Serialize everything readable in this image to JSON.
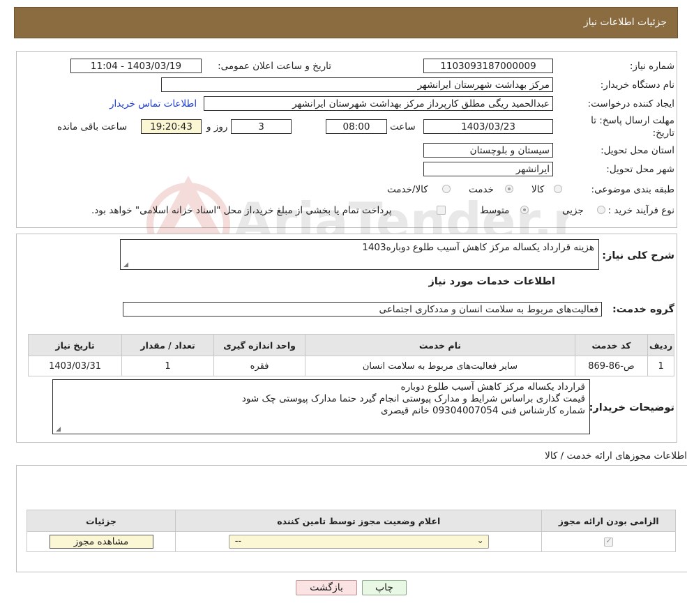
{
  "header": {
    "title": "جزئیات اطلاعات نیاز"
  },
  "need": {
    "number_label": "شماره نیاز:",
    "number": "1103093187000009",
    "announce_label": "تاریخ و ساعت اعلان عمومی:",
    "announce_value": "1403/03/19 - 11:04",
    "buyer_label": "نام دستگاه خریدار:",
    "buyer": "مرکز بهداشت شهرستان ایرانشهر",
    "creator_label": "ایجاد کننده درخواست:",
    "creator": "عبدالحمید ریگی مطلق کارپرداز مرکز بهداشت شهرستان ایرانشهر",
    "contact_link": "اطلاعات تماس خریدار",
    "deadline_label_1": "مهلت ارسال پاسخ: تا",
    "deadline_label_2": "تاریخ:",
    "deadline_date": "1403/03/23",
    "time_label": "ساعت",
    "deadline_time": "08:00",
    "days": "3",
    "days_label": "روز و",
    "remaining": "19:20:43",
    "remaining_label": "ساعت باقی مانده",
    "province_label": "استان محل تحویل:",
    "province": "سیستان و بلوچستان",
    "city_label": "شهر محل تحویل:",
    "city": "ایرانشهر",
    "category_label": "طبقه بندی موضوعی:",
    "category_options": [
      "کالا",
      "خدمت",
      "کالا/خدمت"
    ],
    "process_label": "نوع فرآیند خرید :",
    "process_options": [
      "جزیی",
      "متوسط"
    ],
    "payment_note": "پرداخت تمام یا بخشی از مبلغ خرید،از محل \"اسناد خزانه اسلامی\" خواهد بود."
  },
  "summary": {
    "label": "شرح کلی نیاز:",
    "value": "هزینه قرارداد یکساله مرکز کاهش آسیب طلوع دوباره1403",
    "services_title": "اطلاعات خدمات مورد نیاز",
    "group_label": "گروه خدمت:",
    "group_value": "فعالیت‌های مربوط به سلامت انسان و مددکاری اجتماعی"
  },
  "services_table": {
    "headers": [
      "ردیف",
      "کد خدمت",
      "نام خدمت",
      "واحد اندازه گیری",
      "تعداد / مقدار",
      "تاریخ نیاز"
    ],
    "rows": [
      [
        "1",
        "ص-86-869",
        "سایر فعالیت‌های مربوط به سلامت انسان",
        "فقره",
        "1",
        "1403/03/31"
      ]
    ]
  },
  "buyer_notes": {
    "label": "توضیحات خریدار:",
    "line1": "قرارداد یکساله مرکز کاهش آسیب طلوع دوباره",
    "line2": "قیمت گذاری براساس شرایط و مدارک پیوستی انجام گیرد حتما مدارک پیوستی چک شود",
    "line3": "شماره کارشناس فنی 09304007054 خانم قیصری"
  },
  "permits": {
    "title": "اطلاعات مجوزهای ارائه خدمت / کالا",
    "headers": [
      "الزامی بودن ارائه مجوز",
      "اعلام وضعیت مجوز توسط تامین کننده",
      "جزئیات"
    ],
    "select_value": "--",
    "view_button": "مشاهده مجوز"
  },
  "buttons": {
    "print": "چاپ",
    "back": "بازگشت"
  },
  "watermark": {
    "text": "AriaTender.neT"
  }
}
